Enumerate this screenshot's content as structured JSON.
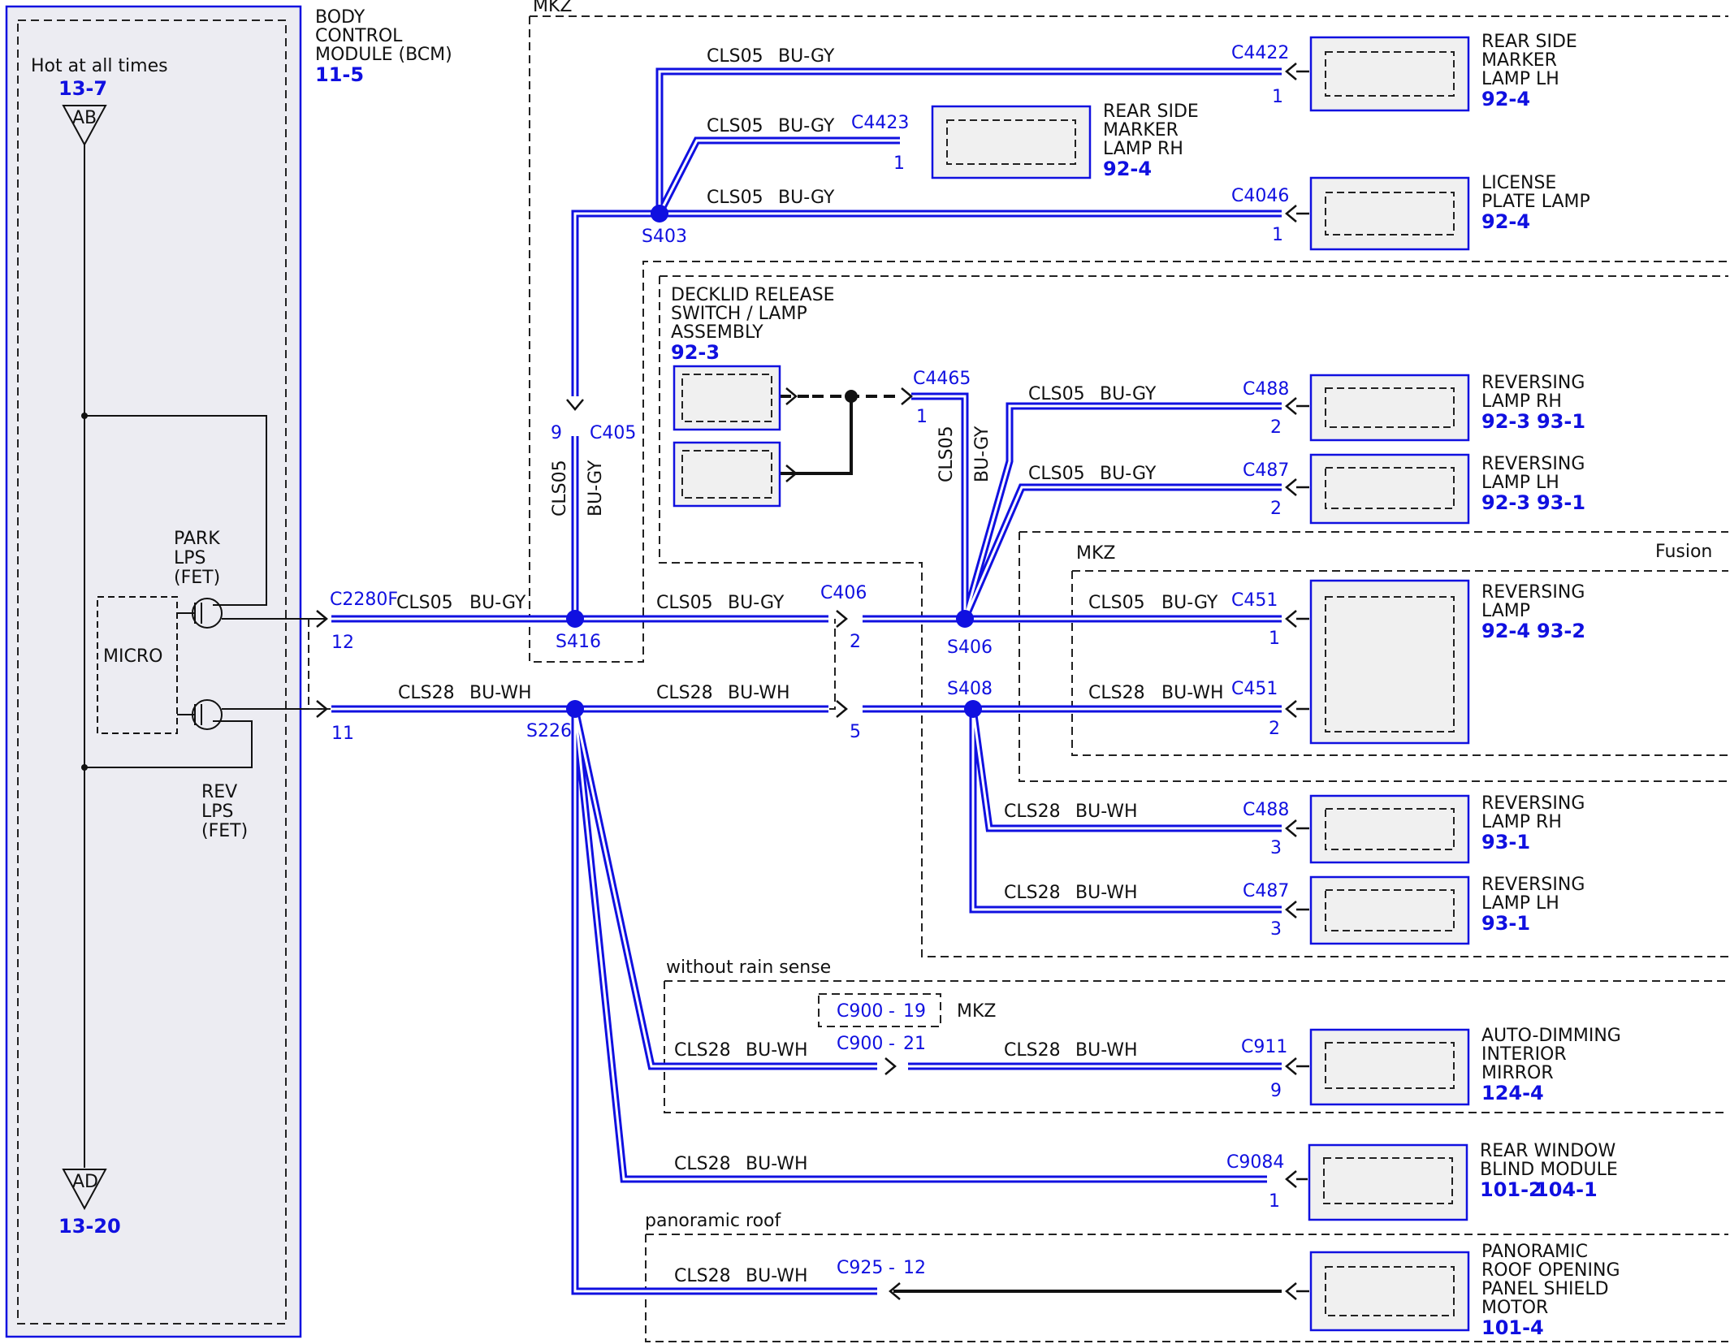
{
  "colors": {
    "wire_blue": "#1010e0",
    "module_fill": "#f0f0f0",
    "text_black": "#111111",
    "ref_blue": "#1010e0"
  },
  "bcm": {
    "title_lines": [
      "BODY",
      "CONTROL",
      "MODULE (BCM)"
    ],
    "ref": "11-5",
    "hot_label": "Hot at all times",
    "hot_ref": "13-7",
    "top_terminal": "AB",
    "bottom_terminal": "AD",
    "bottom_ref": "13-20",
    "micro": "MICRO",
    "park_lines": [
      "PARK",
      "LPS",
      "(FET)"
    ],
    "rev_lines": [
      "REV",
      "LPS",
      "(FET)"
    ]
  },
  "regions": {
    "mkz_top": "MKZ",
    "mkz_mid": "MKZ",
    "fusion": "Fusion",
    "without_rain_sense": "without rain sense",
    "mkz_small": "MKZ",
    "panoramic_roof": "panoramic roof"
  },
  "wires": {
    "cls05": "CLS05",
    "bugy": "BU-GY",
    "cls28": "CLS28",
    "buwh": "BU-WH"
  },
  "connectors": {
    "c2280f": "C2280F",
    "c2280f_pin12": "12",
    "c2280f_pin11": "11",
    "c405": "C405",
    "c405_pin": "9",
    "c406": "C406",
    "c406_pin2": "2",
    "c406_pin5": "5",
    "c4422": "C4422",
    "c4423": "C4423",
    "c4046": "C4046",
    "c4465": "C4465",
    "c488": "C488",
    "c487": "C487",
    "c451": "C451",
    "c911": "C911",
    "c900_19": "C900",
    "c900_19_pin": "19",
    "c900_21": "C900",
    "c900_21_pin": "21",
    "c9084": "C9084",
    "c925": "C925",
    "c925_pin": "12",
    "dash": "-",
    "pin1": "1",
    "pin2": "2",
    "pin3": "3",
    "pin9": "9"
  },
  "splices": {
    "s403": "S403",
    "s416": "S416",
    "s406": "S406",
    "s408": "S408",
    "s226": "S226"
  },
  "components": [
    {
      "name": [
        "REAR SIDE",
        "MARKER",
        "LAMP LH"
      ],
      "refs": [
        "92-4"
      ]
    },
    {
      "name": [
        "REAR SIDE",
        "MARKER",
        "LAMP RH"
      ],
      "refs": [
        "92-4"
      ]
    },
    {
      "name": [
        "LICENSE",
        "PLATE LAMP"
      ],
      "refs": [
        "92-4"
      ]
    },
    {
      "name": [
        "DECKLID RELEASE",
        "SWITCH / LAMP",
        "ASSEMBLY"
      ],
      "refs": [
        "92-3"
      ]
    },
    {
      "name": [
        "REVERSING",
        "LAMP RH"
      ],
      "refs": [
        "92-3",
        "93-1"
      ]
    },
    {
      "name": [
        "REVERSING",
        "LAMP LH"
      ],
      "refs": [
        "92-3",
        "93-1"
      ]
    },
    {
      "name": [
        "REVERSING",
        "LAMP"
      ],
      "refs": [
        "92-4",
        "93-2"
      ]
    },
    {
      "name": [
        "REVERSING",
        "LAMP RH"
      ],
      "refs": [
        "93-1"
      ]
    },
    {
      "name": [
        "REVERSING",
        "LAMP LH"
      ],
      "refs": [
        "93-1"
      ]
    },
    {
      "name": [
        "AUTO-DIMMING",
        "INTERIOR",
        "MIRROR"
      ],
      "refs": [
        "124-4"
      ]
    },
    {
      "name": [
        "REAR WINDOW",
        "BLIND MODULE"
      ],
      "refs": [
        "101-2",
        "104-1"
      ]
    },
    {
      "name": [
        "PANORAMIC",
        "ROOF OPENING",
        "PANEL SHIELD",
        "MOTOR"
      ],
      "refs": [
        "101-4"
      ]
    }
  ]
}
